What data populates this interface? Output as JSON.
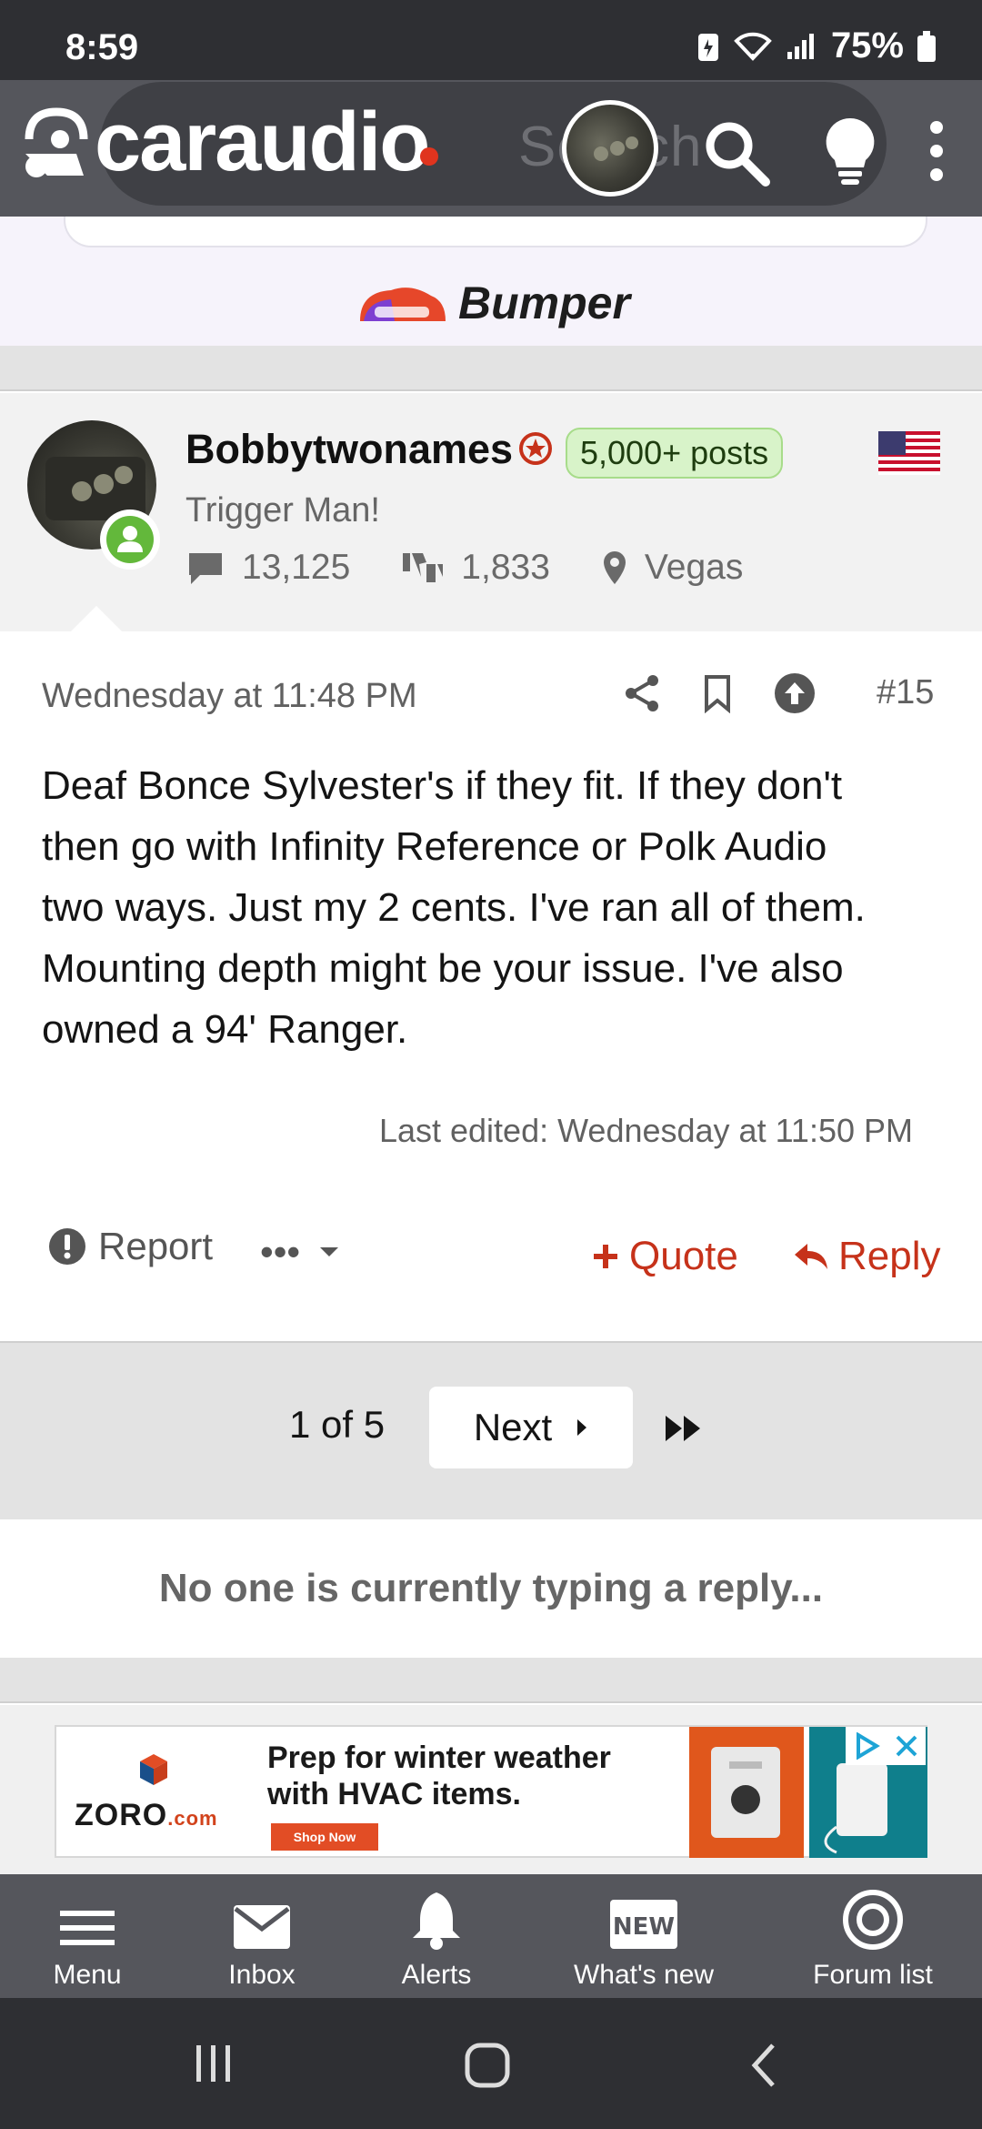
{
  "status_bar": {
    "time": "8:59",
    "battery": "75%"
  },
  "header": {
    "logo_text": "caraudio",
    "search_placeholder": "Search"
  },
  "ad_top": {
    "brand": "Bumper"
  },
  "post": {
    "username": "Bobbytwonames",
    "posts_badge": "5,000+ posts",
    "user_title": "Trigger Man!",
    "messages": "13,125",
    "reactions": "1,833",
    "location": "Vegas",
    "timestamp": "Wednesday at 11:48 PM",
    "number": "#15",
    "body_lines": [
      "Deaf Bonce Sylvester's if they fit. If they don't",
      "then go with Infinity Reference or Polk Audio",
      "two ways. Just my 2 cents. I've ran all of them.",
      "Mounting depth might be your issue. I've also",
      "owned a 94' Ranger."
    ],
    "last_edited": "Last edited: Wednesday at 11:50 PM",
    "report_label": "Report",
    "more_label": "•••",
    "quote_label": "Quote",
    "reply_label": "Reply"
  },
  "pagination": {
    "page_count": "1 of 5",
    "next_label": "Next"
  },
  "typing_status": "No one is currently typing a reply...",
  "ad_bottom": {
    "brand": "ZORO",
    "brand_suffix": ".com",
    "headline_line1": "Prep for winter weather",
    "headline_line2": "with HVAC items.",
    "cta": "Shop Now"
  },
  "bottom_nav": {
    "items": [
      {
        "label": "Menu",
        "icon": "menu-icon"
      },
      {
        "label": "Inbox",
        "icon": "inbox-icon"
      },
      {
        "label": "Alerts",
        "icon": "bell-icon"
      },
      {
        "label": "What's new",
        "icon": "new-icon",
        "badge": "NEW"
      },
      {
        "label": "Forum list",
        "icon": "forum-list-icon"
      }
    ]
  },
  "colors": {
    "accent": "#c6321a",
    "header_bg": "#55565c",
    "online": "#63b83b"
  }
}
